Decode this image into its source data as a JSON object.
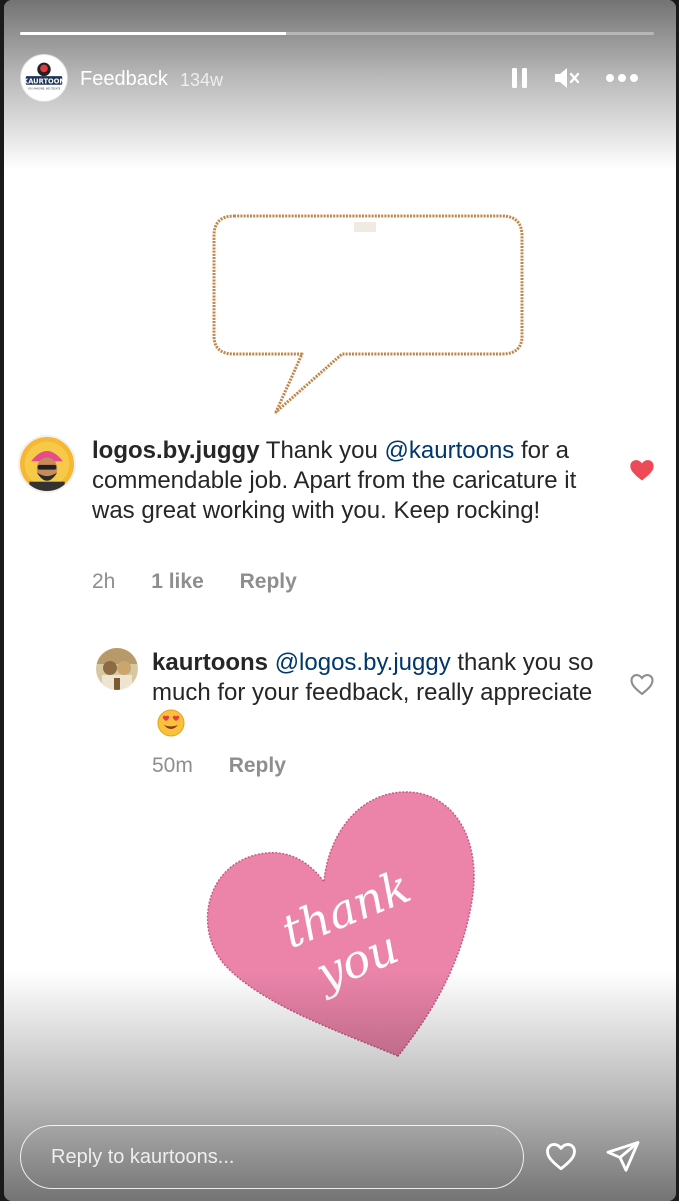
{
  "story": {
    "progress": 0.42,
    "username": "Feedback",
    "age": "134w",
    "avatar": {
      "brand_text": "KAURTOON",
      "tagline": "YOU IMAGINE, WE CREATE"
    }
  },
  "header_icons": [
    "pause-icon",
    "mute-icon",
    "more-icon"
  ],
  "comment": {
    "username": "logos.by.juggy",
    "text_before": "Thank you",
    "mention": "@kaurtoons",
    "text_after": "for a commendable job. Apart from the caricature it was great working with you. Keep rocking!",
    "time": "2h",
    "likes": "1 like",
    "reply_label": "Reply",
    "liked": true
  },
  "reply": {
    "username": "kaurtoons",
    "mention": "@logos.by.juggy",
    "text": "thank you so much for your feedback, really appreciate",
    "emoji": "heart-eyes-emoji",
    "time": "50m",
    "reply_label": "Reply",
    "liked": false
  },
  "sticker": {
    "line1": "thank",
    "line2": "you"
  },
  "footer": {
    "reply_placeholder": "Reply to kaurtoons...",
    "icons": [
      "heart-icon",
      "send-icon"
    ]
  },
  "colors": {
    "heart_red": "#ed4956",
    "sticker_pink": "#ec84aa",
    "bubble_stroke": "#c08548",
    "mention": "#00376b"
  }
}
